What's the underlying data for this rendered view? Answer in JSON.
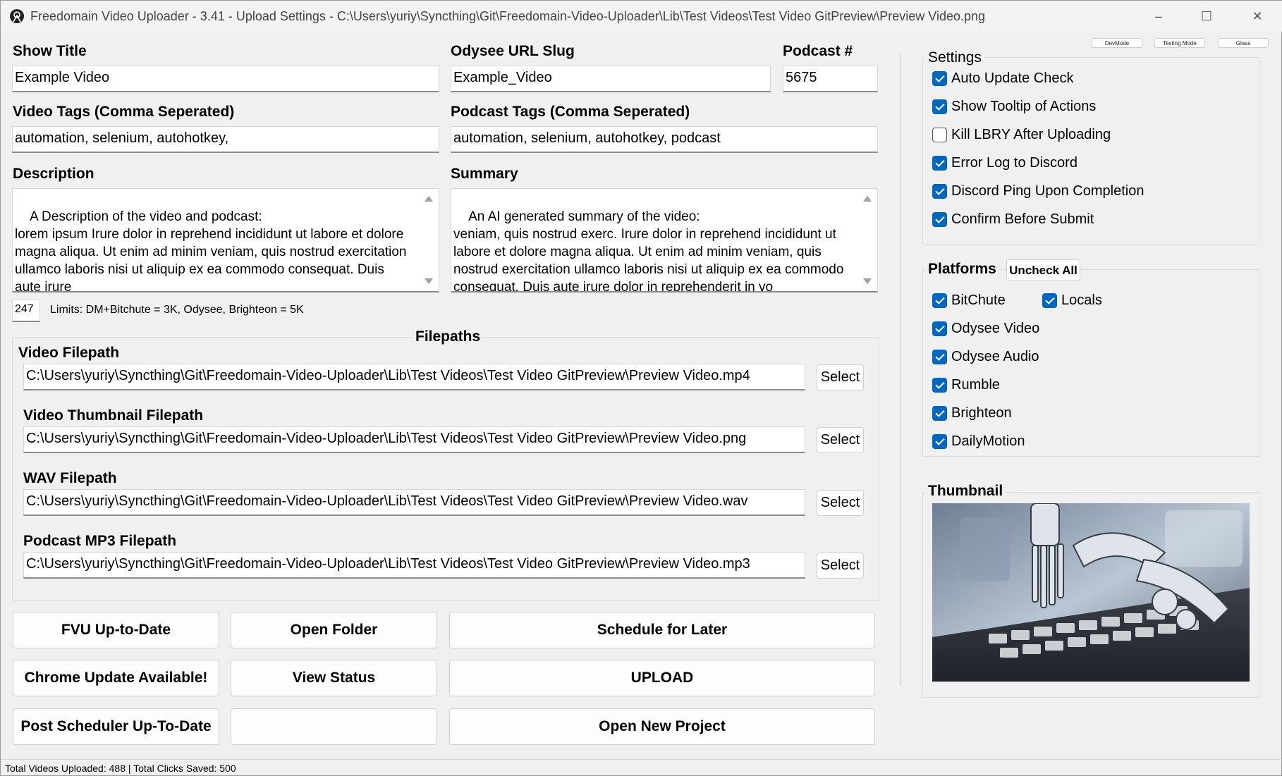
{
  "window": {
    "title": "Freedomain Video Uploader - 3.41 - Upload Settings - C:\\Users\\yuriy\\Syncthing\\Git\\Freedomain-Video-Uploader\\Lib\\Test Videos\\Test Video GitPreview\\Preview Video.png",
    "icon": "app-logo-icon",
    "controls": {
      "minimize": "–",
      "maximize": "☐",
      "close": "✕"
    }
  },
  "form": {
    "show_title_label": "Show Title",
    "show_title_value": "Example Video",
    "slug_label": "Odysee URL Slug",
    "slug_value": "Example_Video",
    "podcast_num_label": "Podcast #",
    "podcast_num_value": "5675",
    "video_tags_label": "Video Tags (Comma Seperated)",
    "video_tags_value": "automation, selenium, autohotkey,",
    "podcast_tags_label": "Podcast Tags (Comma Seperated)",
    "podcast_tags_value": "automation, selenium, autohotkey, podcast",
    "description_label": "Description",
    "description_value": "A Description of the video and podcast:\nlorem ipsum Irure dolor in reprehend incididunt ut labore et dolore magna aliqua. Ut enim ad minim veniam, quis nostrud exercitation ullamco laboris nisi ut aliquip ex ea commodo consequat. Duis aute irure",
    "summary_label": "Summary",
    "summary_value": "An AI generated summary of the video:\nveniam, quis nostrud exerc. Irure dolor in reprehend incididunt ut labore et dolore magna aliqua. Ut enim ad minim veniam, quis nostrud exercitation ullamco laboris nisi ut aliquip ex ea commodo consequat. Duis aute irure dolor in reprehenderit in vo",
    "char_count": "247",
    "limits_text": "Limits: DM+Bitchute = 3K, Odysee, Brighteon = 5K"
  },
  "filepaths": {
    "group_title": "Filepaths",
    "select_label": "Select",
    "items": [
      {
        "label": "Video Filepath",
        "value": "C:\\Users\\yuriy\\Syncthing\\Git\\Freedomain-Video-Uploader\\Lib\\Test Videos\\Test Video GitPreview\\Preview Video.mp4"
      },
      {
        "label": "Video Thumbnail Filepath",
        "value": "C:\\Users\\yuriy\\Syncthing\\Git\\Freedomain-Video-Uploader\\Lib\\Test Videos\\Test Video GitPreview\\Preview Video.png"
      },
      {
        "label": "WAV Filepath",
        "value": "C:\\Users\\yuriy\\Syncthing\\Git\\Freedomain-Video-Uploader\\Lib\\Test Videos\\Test Video GitPreview\\Preview Video.wav"
      },
      {
        "label": "Podcast MP3 Filepath",
        "value": "C:\\Users\\yuriy\\Syncthing\\Git\\Freedomain-Video-Uploader\\Lib\\Test Videos\\Test Video GitPreview\\Preview Video.mp3"
      }
    ]
  },
  "actions": {
    "fvu_uptodate": "FVU Up-to-Date",
    "open_folder": "Open Folder",
    "schedule_later": "Schedule for Later",
    "chrome_update": "Chrome Update Available!",
    "view_status": "View Status",
    "upload": "UPLOAD",
    "post_scheduler": "Post Scheduler Up-To-Date",
    "blank": "",
    "open_new_project": "Open New Project"
  },
  "modes": {
    "dev": "DevMode",
    "testing": "Testing Mode",
    "glass": "Glass"
  },
  "settings": {
    "title": "Settings",
    "items": [
      {
        "label": "Auto Update Check",
        "checked": true
      },
      {
        "label": "Show Tooltip of Actions",
        "checked": true
      },
      {
        "label": "Kill LBRY After Uploading",
        "checked": false
      },
      {
        "label": "Error Log to Discord",
        "checked": true
      },
      {
        "label": "Discord Ping Upon Completion",
        "checked": true
      },
      {
        "label": "Confirm Before Submit",
        "checked": true
      }
    ]
  },
  "platforms": {
    "title": "Platforms",
    "uncheck_all": "Uncheck All",
    "items": [
      {
        "label": "BitChute",
        "checked": true
      },
      {
        "label": "Locals",
        "checked": true
      },
      {
        "label": "Odysee Video",
        "checked": true
      },
      {
        "label": "Odysee Audio",
        "checked": true
      },
      {
        "label": "Rumble",
        "checked": true
      },
      {
        "label": "Brighteon",
        "checked": true
      },
      {
        "label": "DailyMotion",
        "checked": true
      }
    ]
  },
  "thumbnail": {
    "title": "Thumbnail"
  },
  "status": {
    "text": "Total Videos Uploaded: 488 | Total Clicks Saved: 500"
  },
  "colors": {
    "accent": "#0067c0",
    "background": "#f0f0f0"
  }
}
